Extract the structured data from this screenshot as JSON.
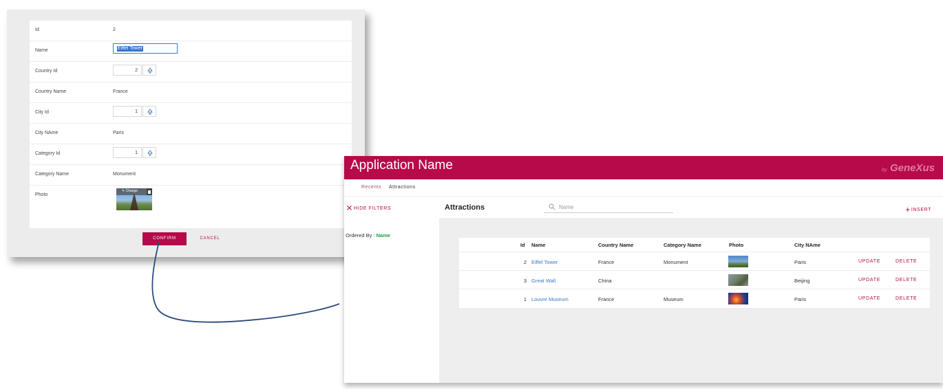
{
  "form": {
    "fields": [
      {
        "label": "Id",
        "value": "2"
      },
      {
        "label": "Name",
        "value": "Eiffel Tower"
      },
      {
        "label": "Country Id",
        "value": "2"
      },
      {
        "label": "Country Name",
        "value": "France"
      },
      {
        "label": "City Id",
        "value": "1"
      },
      {
        "label": "City NAme",
        "value": "Paris"
      },
      {
        "label": "Category Id",
        "value": "1"
      },
      {
        "label": "Category Name",
        "value": "Monument"
      },
      {
        "label": "Photo"
      }
    ],
    "photo_change_label": "Change",
    "confirm_label": "CONFIRM",
    "cancel_label": "CANCEL"
  },
  "app": {
    "title": "Application Name",
    "brand_by": "by",
    "brand_name": "GeneXus",
    "tabs": [
      {
        "label": "Recents"
      },
      {
        "label": "Attractions"
      }
    ],
    "hide_filters_label": "HIDE FILTERS",
    "page_title": "Attractions",
    "search_placeholder": "Name",
    "insert_label": "INSERT",
    "ordered_by_label": "Ordered By : ",
    "ordered_by_value": "Name",
    "grid": {
      "headers": [
        "Id",
        "Name",
        "Country Name",
        "Category Name",
        "Photo",
        "City NAme"
      ],
      "rows": [
        {
          "id": "2",
          "name": "Eiffel Tower",
          "country": "France",
          "category": "Monument",
          "city": "Paris",
          "update": "UPDATE",
          "delete": "DELETE"
        },
        {
          "id": "3",
          "name": "Great Wall",
          "country": "China",
          "category": "",
          "city": "Beijing",
          "update": "UPDATE",
          "delete": "DELETE"
        },
        {
          "id": "1",
          "name": "Louvre Museum",
          "country": "France",
          "category": "Museum",
          "city": "Paris",
          "update": "UPDATE",
          "delete": "DELETE"
        }
      ]
    }
  },
  "colors": {
    "brand": "#b70a4a",
    "link": "#3a78c2",
    "ordered_by_value": "#1c9c54",
    "connector": "#2c4a7c"
  }
}
